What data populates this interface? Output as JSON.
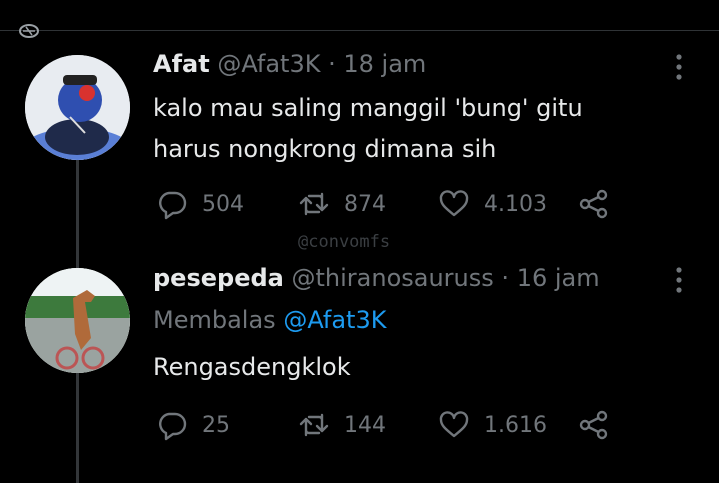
{
  "colors": {
    "background": "#000000",
    "text": "#e7e9ea",
    "muted": "#71767b",
    "link": "#1d9bf0"
  },
  "watermark": "@convomfs",
  "tweets": [
    {
      "name": "Afat",
      "handle": "@Afat3K",
      "separator": "·",
      "time": "18 jam",
      "lines": [
        "kalo mau saling manggil 'bung' gitu",
        "harus nongkrong dimana sih"
      ],
      "replies": "504",
      "retweets": "874",
      "likes": "4.103"
    },
    {
      "name": "pesepeda",
      "handle": "@thiranosauruss",
      "separator": "·",
      "time": "16 jam",
      "reply_prefix": "Membalas",
      "reply_to": "@Afat3K",
      "lines": [
        "Rengasdengklok"
      ],
      "replies": "25",
      "retweets": "144",
      "likes": "1.616"
    }
  ],
  "icons": [
    "reply-icon",
    "retweet-icon",
    "like-icon",
    "share-icon",
    "more-icon"
  ]
}
